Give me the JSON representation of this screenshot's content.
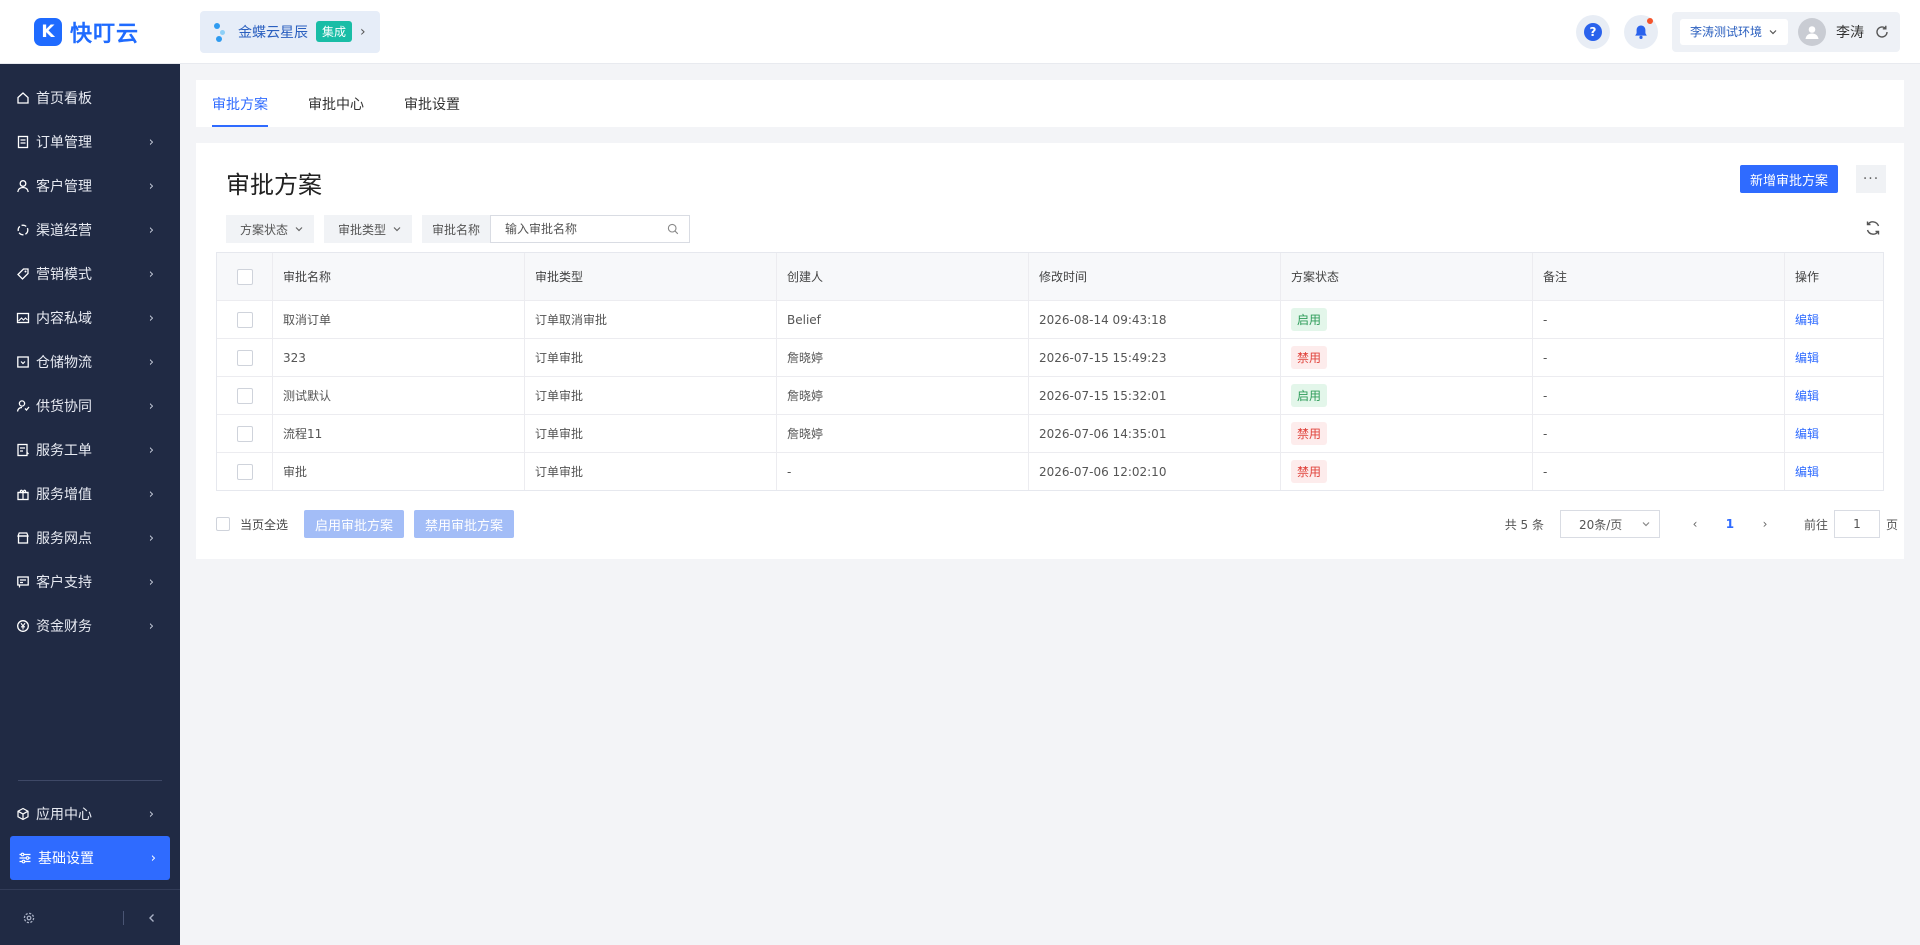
{
  "app": {
    "logo_mark": "K",
    "logo_text": "快叮云"
  },
  "integration": {
    "name": "金蝶云星辰",
    "badge": "集成"
  },
  "header": {
    "env_label": "李涛测试环境",
    "user_name": "李涛"
  },
  "sidebar": {
    "items": [
      {
        "label": "首页看板",
        "icon": "home-icon",
        "has_children": false
      },
      {
        "label": "订单管理",
        "icon": "order-icon",
        "has_children": true
      },
      {
        "label": "客户管理",
        "icon": "customer-icon",
        "has_children": true
      },
      {
        "label": "渠道经营",
        "icon": "channel-icon",
        "has_children": true
      },
      {
        "label": "营销模式",
        "icon": "tag-icon",
        "has_children": true
      },
      {
        "label": "内容私域",
        "icon": "image-icon",
        "has_children": true
      },
      {
        "label": "仓储物流",
        "icon": "warehouse-icon",
        "has_children": true
      },
      {
        "label": "供货协同",
        "icon": "supply-icon",
        "has_children": true
      },
      {
        "label": "服务工单",
        "icon": "ticket-icon",
        "has_children": true
      },
      {
        "label": "服务增值",
        "icon": "gift-icon",
        "has_children": true
      },
      {
        "label": "服务网点",
        "icon": "store-icon",
        "has_children": true
      },
      {
        "label": "客户支持",
        "icon": "support-icon",
        "has_children": true
      },
      {
        "label": "资金财务",
        "icon": "yuan-icon",
        "has_children": true
      }
    ],
    "bottom_items": [
      {
        "label": "应用中心",
        "icon": "cube-icon"
      },
      {
        "label": "基础设置",
        "icon": "settings-sliders-icon"
      }
    ]
  },
  "tabs": [
    {
      "label": "审批方案",
      "active": true
    },
    {
      "label": "审批中心",
      "active": false
    },
    {
      "label": "审批设置",
      "active": false
    }
  ],
  "main": {
    "title": "审批方案",
    "add_button": "新增审批方案",
    "more_button": "···",
    "filters": [
      {
        "label": "方案状态"
      },
      {
        "label": "审批类型"
      }
    ],
    "search": {
      "label": "审批名称",
      "placeholder": "输入审批名称",
      "value": ""
    }
  },
  "table": {
    "columns": [
      "审批名称",
      "审批类型",
      "创建人",
      "修改时间",
      "方案状态",
      "备注",
      "操作"
    ],
    "rows": [
      {
        "name": "取消订单",
        "type": "订单取消审批",
        "creator": "Belief",
        "modified": "2026-08-14 09:43:18",
        "status": "启用",
        "status_on": true,
        "remark": "-",
        "action": "编辑"
      },
      {
        "name": "323",
        "type": "订单审批",
        "creator": "詹晓婷",
        "modified": "2026-07-15 15:49:23",
        "status": "禁用",
        "status_on": false,
        "remark": "-",
        "action": "编辑"
      },
      {
        "name": "测试默认",
        "type": "订单审批",
        "creator": "詹晓婷",
        "modified": "2026-07-15 15:32:01",
        "status": "启用",
        "status_on": true,
        "remark": "-",
        "action": "编辑"
      },
      {
        "name": "流程11",
        "type": "订单审批",
        "creator": "詹晓婷",
        "modified": "2026-07-06 14:35:01",
        "status": "禁用",
        "status_on": false,
        "remark": "-",
        "action": "编辑"
      },
      {
        "name": "审批",
        "type": "订单审批",
        "creator": "-",
        "modified": "2026-07-06 12:02:10",
        "status": "禁用",
        "status_on": false,
        "remark": "-",
        "action": "编辑"
      }
    ]
  },
  "footer": {
    "select_page_label": "当页全选",
    "enable_button": "启用审批方案",
    "disable_button": "禁用审批方案",
    "total_label": "共 5 条",
    "page_size": "20条/页",
    "current_page": "1",
    "goto_prefix": "前往",
    "goto_value": "1",
    "goto_suffix": "页"
  },
  "colors": {
    "primary": "#2f6bff",
    "sidebar_bg": "#202a44",
    "enabled": "#2e9c5a",
    "disabled": "#e0433c"
  }
}
